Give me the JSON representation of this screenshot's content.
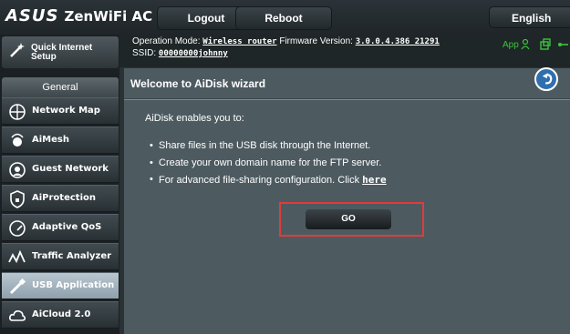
{
  "header": {
    "brand": "ASUS",
    "model": "ZenWiFi AC",
    "logout_label": "Logout",
    "reboot_label": "Reboot",
    "language": "English"
  },
  "sidebar": {
    "quick_setup": "Quick Internet Setup",
    "general_label": "General",
    "items": [
      {
        "label": "Network Map",
        "icon": "network-map-icon"
      },
      {
        "label": "AiMesh",
        "icon": "aimesh-icon"
      },
      {
        "label": "Guest Network",
        "icon": "guest-network-icon"
      },
      {
        "label": "AiProtection",
        "icon": "shield-icon"
      },
      {
        "label": "Adaptive QoS",
        "icon": "gauge-icon"
      },
      {
        "label": "Traffic Analyzer",
        "icon": "traffic-icon"
      },
      {
        "label": "USB Application",
        "icon": "usb-icon"
      },
      {
        "label": "AiCloud 2.0",
        "icon": "cloud-icon"
      }
    ],
    "active": "USB Application"
  },
  "status": {
    "op_mode_label": "Operation Mode:",
    "op_mode_value": "Wireless router",
    "fw_label": "Firmware Version:",
    "fw_value": "3.0.0.4.386_21291",
    "ssid_label": "SSID:",
    "ssid_value": "00000000johnny",
    "app_label": "App"
  },
  "content": {
    "title": "Welcome to AiDisk wizard",
    "intro": "AiDisk enables you to:",
    "bullets": [
      "Share files in the USB disk through the Internet.",
      "Create your own domain name for the FTP server.",
      "For advanced file-sharing configuration. Click"
    ],
    "here_link": "here",
    "go_label": "GO"
  },
  "colors": {
    "accent_red": "#e13b3b",
    "app_green": "#3cc43c"
  }
}
